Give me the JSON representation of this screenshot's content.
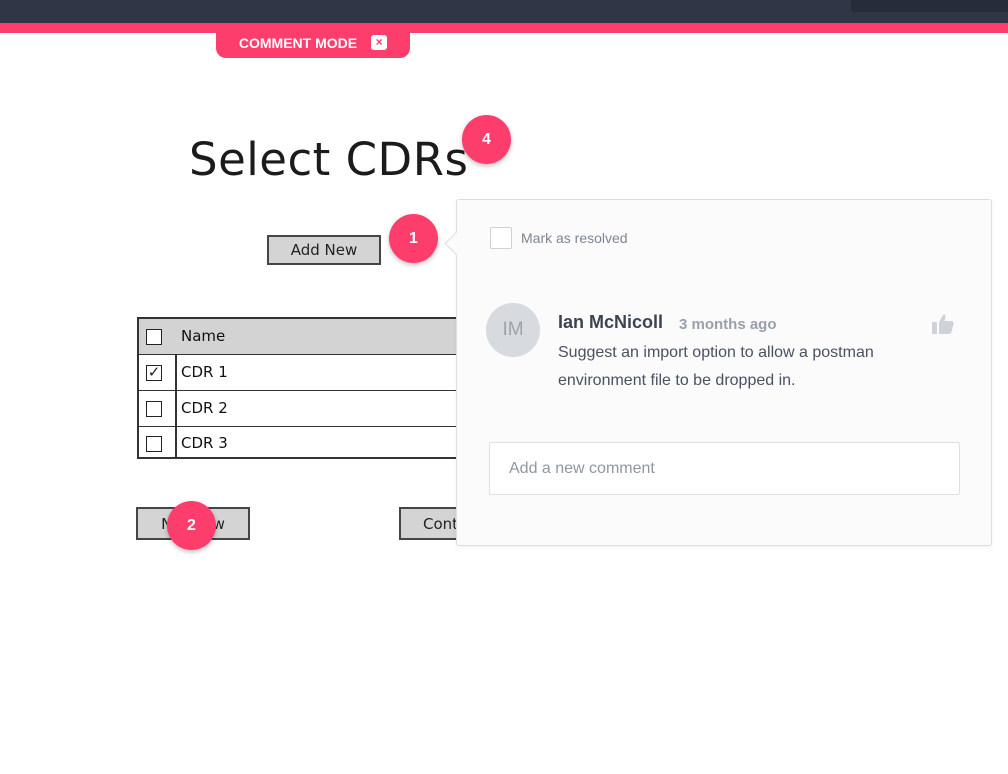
{
  "header": {
    "mode_label": "COMMENT MODE",
    "close_glyph": "×",
    "accent_color": "#fd3e6c",
    "bar_color": "#2f3747"
  },
  "wireframe": {
    "title": "Select CDRs",
    "add_new_label": "Add New",
    "table": {
      "header": "Name",
      "rows": [
        {
          "label": "CDR 1",
          "checked": true
        },
        {
          "label": "CDR 2",
          "checked": false
        },
        {
          "label": "CDR 3",
          "checked": false
        }
      ]
    },
    "left_button_label": "Not Now",
    "right_button_label": "Cont"
  },
  "pins": [
    {
      "number": "4"
    },
    {
      "number": "1"
    },
    {
      "number": "2"
    }
  ],
  "comment_panel": {
    "resolve_label": "Mark as resolved",
    "comment": {
      "avatar_initials": "IM",
      "author": "Ian McNicoll",
      "time": "3 months ago",
      "text": "Suggest an import option to allow a postman environment file to be dropped in.",
      "like_icon": "thumbs-up-icon"
    },
    "new_comment_placeholder": "Add a new comment"
  }
}
